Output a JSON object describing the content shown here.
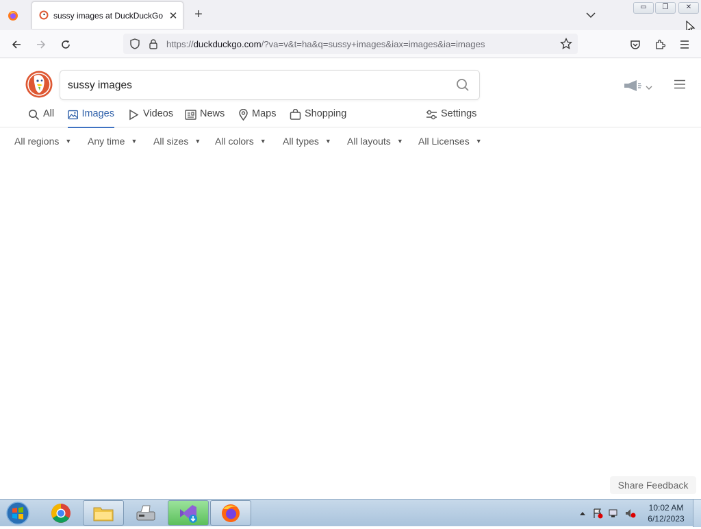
{
  "browser": {
    "tab": {
      "title": "sussy images at DuckDuckGo",
      "close": "✕"
    },
    "new_tab": "+",
    "window_controls": {
      "minimize": "▭",
      "restore": "❐",
      "close": "✕"
    },
    "url": {
      "prefix": "https://",
      "domain": "duckduckgo.com",
      "path": "/?va=v&t=ha&q=sussy+images&iax=images&ia=images"
    }
  },
  "search": {
    "query": "sussy images"
  },
  "tabs": [
    {
      "label": "All",
      "icon": "search-icon"
    },
    {
      "label": "Images",
      "icon": "image-icon",
      "active": true
    },
    {
      "label": "Videos",
      "icon": "play-icon"
    },
    {
      "label": "News",
      "icon": "news-icon"
    },
    {
      "label": "Maps",
      "icon": "map-pin-icon"
    },
    {
      "label": "Shopping",
      "icon": "shopping-bag-icon"
    },
    {
      "label": "Settings",
      "icon": "settings-sliders-icon"
    }
  ],
  "filters": [
    {
      "label": "All regions"
    },
    {
      "label": "Any time"
    },
    {
      "label": "All sizes"
    },
    {
      "label": "All colors"
    },
    {
      "label": "All types"
    },
    {
      "label": "All layouts"
    },
    {
      "label": "All Licenses"
    }
  ],
  "feedback": {
    "label": "Share Feedback"
  },
  "taskbar": {
    "apps": [
      "windows-start",
      "chrome",
      "file-explorer",
      "scanner",
      "visual-studio-installer",
      "firefox"
    ],
    "clock": {
      "time": "10:02 AM",
      "date": "6/12/2023"
    }
  },
  "colors": {
    "accent": "#3f72c2",
    "ddg_orange": "#de5833"
  }
}
